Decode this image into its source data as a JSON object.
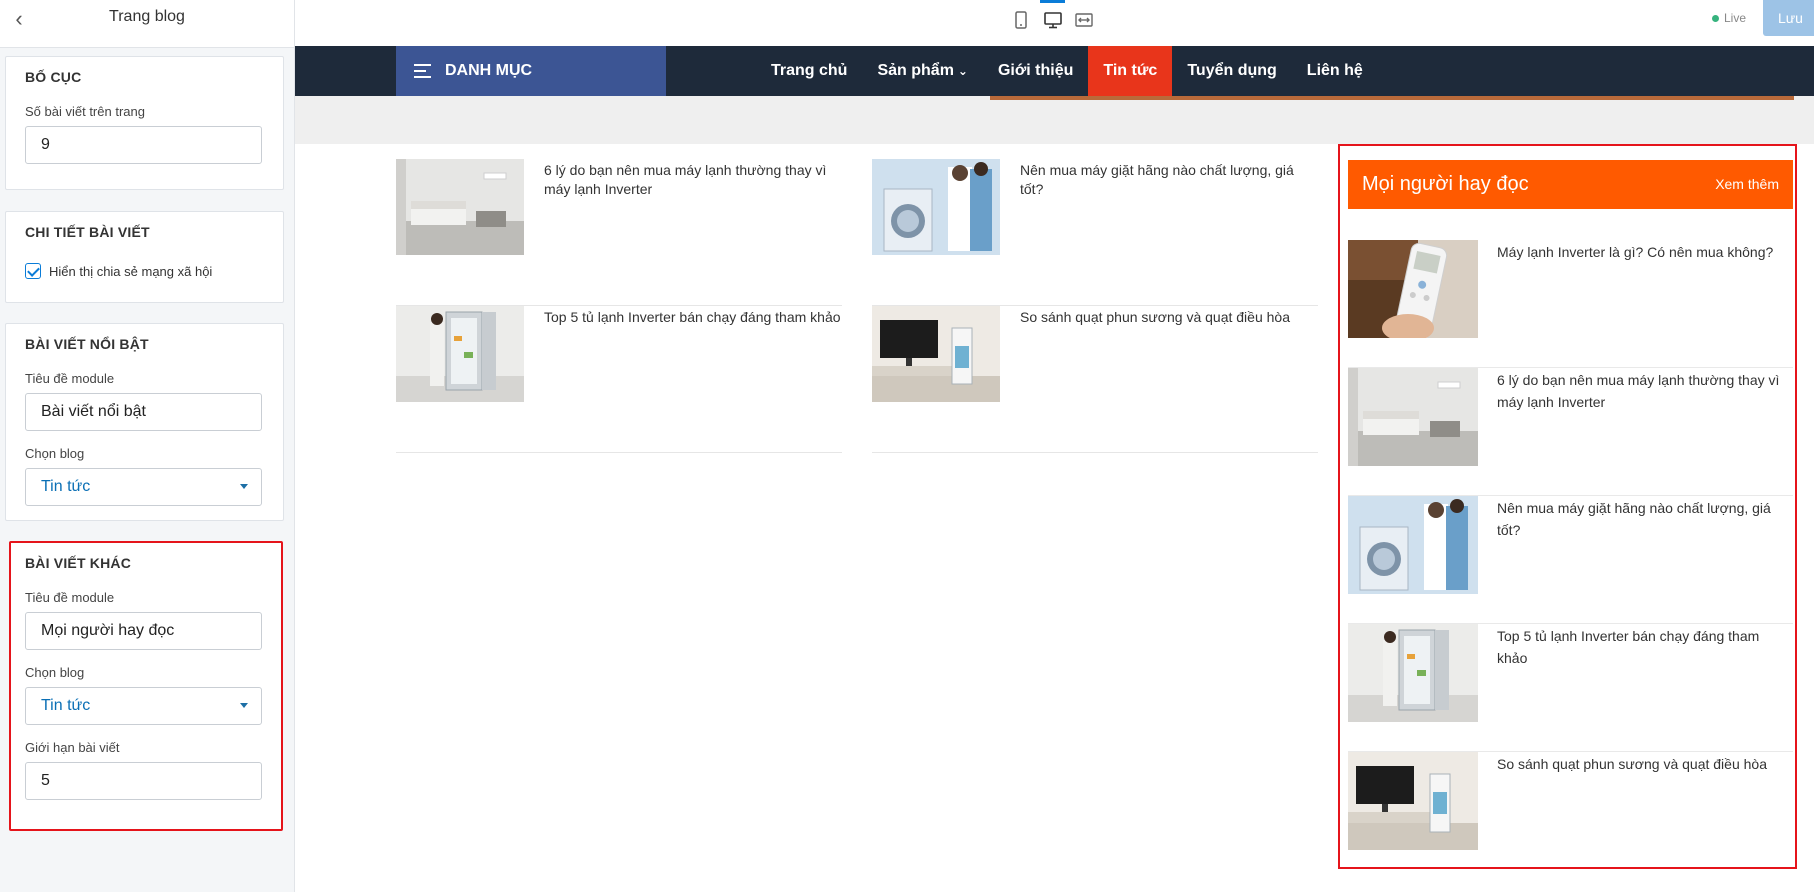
{
  "sidebar": {
    "title": "Trang blog",
    "layout": {
      "title": "BỐ CỤC",
      "posts_per_page_label": "Số bài viết trên trang",
      "posts_per_page_value": "9"
    },
    "post_detail": {
      "title": "CHI TIẾT BÀI VIẾT",
      "share_label": "Hiển thị chia sẻ mạng xã hội",
      "share_checked": true
    },
    "featured": {
      "title": "BÀI VIẾT NỔI BẬT",
      "module_title_label": "Tiêu đề module",
      "module_title_value": "Bài viết nổi bật",
      "blog_label": "Chọn blog",
      "blog_value": "Tin tức"
    },
    "other": {
      "title": "BÀI VIẾT KHÁC",
      "module_title_label": "Tiêu đề module",
      "module_title_value": "Mọi người hay đọc",
      "blog_label": "Chọn blog",
      "blog_value": "Tin tức",
      "limit_label": "Giới hạn bài viết",
      "limit_value": "5"
    }
  },
  "toolbar": {
    "devices": [
      "mobile-icon",
      "desktop-icon",
      "fullwidth-icon"
    ],
    "active_device": "desktop-icon",
    "live_label": "Live",
    "save_label": "Lưu"
  },
  "navbar": {
    "category_label": "DANH MỤC",
    "links": [
      "Trang chủ",
      "Sản phẩm",
      "Giới thiệu",
      "Tin tức",
      "Tuyển dụng",
      "Liên hệ"
    ],
    "active_link": "Tin tức"
  },
  "articles": [
    {
      "title": "6 lý do bạn nên mua máy lạnh thường thay vì máy lạnh Inverter",
      "image": "living-room"
    },
    {
      "title": "Nên mua máy giặt hãng nào chất lượng, giá tốt?",
      "image": "washing-machine"
    },
    {
      "title": "Top 5 tủ lạnh Inverter bán chạy đáng tham khảo",
      "image": "fridge"
    },
    {
      "title": "So sánh quạt phun sương và quạt điều hòa",
      "image": "tv-cooler"
    }
  ],
  "widget": {
    "title": "Mọi người hay đọc",
    "more_label": "Xem thêm",
    "items": [
      {
        "title": "Máy lạnh Inverter là gì? Có nên mua không?",
        "image": "remote"
      },
      {
        "title": "6 lý do bạn nên mua máy lạnh thường thay vì máy lạnh Inverter",
        "image": "living-room"
      },
      {
        "title": "Nên mua máy giặt hãng nào chất lượng, giá tốt?",
        "image": "washing-machine"
      },
      {
        "title": "Top 5 tủ lạnh Inverter bán chạy đáng tham khảo",
        "image": "fridge"
      },
      {
        "title": "So sánh quạt phun sương và quạt điều hòa",
        "image": "tv-cooler"
      }
    ]
  },
  "colors": {
    "nav_bg": "#1e2a3a",
    "category_bg": "#3c5594",
    "active_nav": "#e8351b",
    "widget_head": "#ff5a00",
    "highlight_border": "#e5141b",
    "save_button": "#9dc3e6"
  }
}
